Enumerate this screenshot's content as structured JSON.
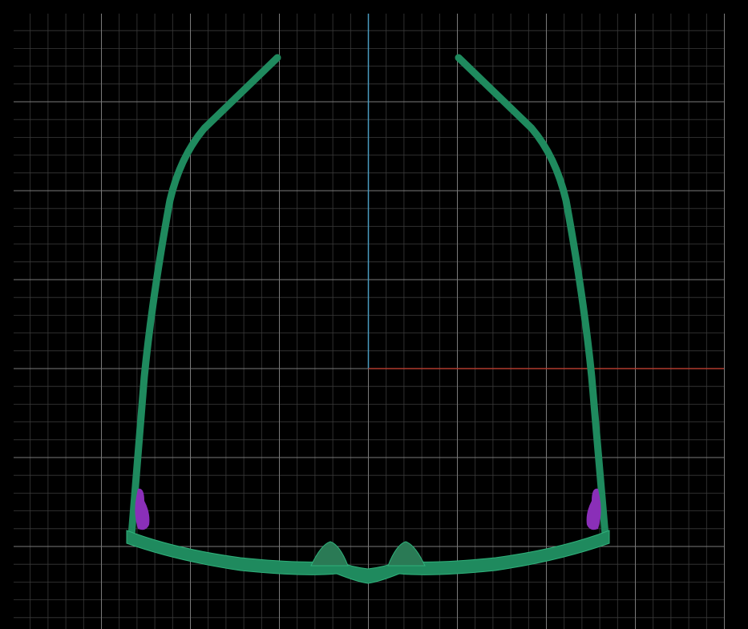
{
  "viewport": {
    "view": "top",
    "background_color": "#000000",
    "grid": {
      "visible": true,
      "minor_color": "#3a3a3a",
      "major_color": "#7a7a7a",
      "subdivisions": 5
    },
    "axes": {
      "x_axis_color": "#b03a2e",
      "y_axis_color": "#4a9bc0"
    }
  },
  "model": {
    "object": "eyeglasses",
    "frame_color": "#1f8a5e",
    "frame_wire_color": "#2fb07a",
    "nose_pad_color": "#2a7a55",
    "hinge_color": "#8a2fb8",
    "display_mode": "wireframe-shaded"
  }
}
